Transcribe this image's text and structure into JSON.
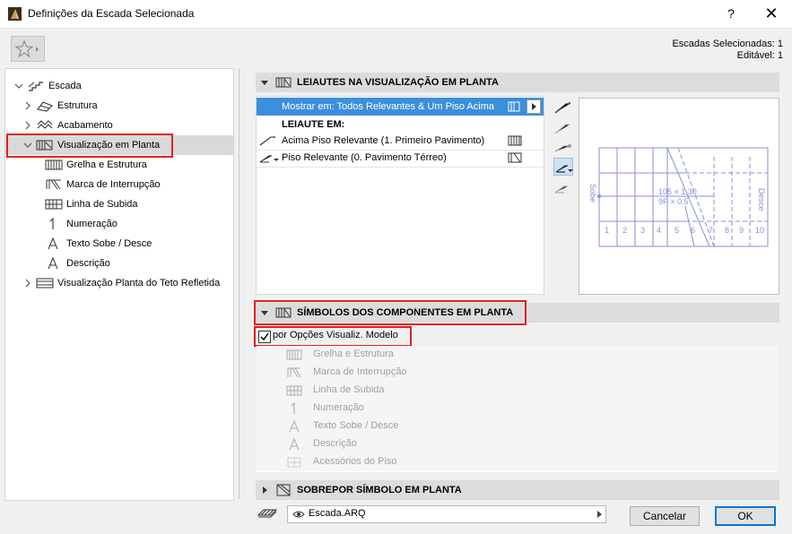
{
  "window": {
    "title": "Definições da Escada Selecionada",
    "help": "?",
    "close": "✕"
  },
  "selection_info": {
    "line1": "Escadas Selecionadas: 1",
    "line2": "Editável: 1"
  },
  "tree": {
    "items": [
      {
        "label": "Escada",
        "icon": "stair-icon"
      },
      {
        "label": "Estrutura",
        "icon": "structure-icon"
      },
      {
        "label": "Acabamento",
        "icon": "finish-icon"
      },
      {
        "label": "Visualização em Planta",
        "icon": "floor-plan-icon"
      },
      {
        "label": "Grelha e Estrutura",
        "icon": "grid-structure-icon"
      },
      {
        "label": "Marca de Interrupção",
        "icon": "break-mark-icon"
      },
      {
        "label": "Linha de Subida",
        "icon": "walking-line-icon"
      },
      {
        "label": "Numeração",
        "icon": "numbering-icon"
      },
      {
        "label": "Texto Sobe / Desce",
        "icon": "up-down-text-icon"
      },
      {
        "label": "Descrição",
        "icon": "description-icon"
      },
      {
        "label": "Visualização Planta do Teto Refletida",
        "icon": "reflected-ceiling-icon"
      }
    ]
  },
  "sections": {
    "layouts_header": "LEIAUTES NA VISUALIZAÇÃO EM PLANTA",
    "symbols_header": "SÍMBOLOS DOS COMPONENTES EM PLANTA",
    "overlay_header": "SOBREPOR SÍMBOLO EM PLANTA"
  },
  "layouts": {
    "show_on": "Mostrar em: Todos Relevantes & Um Piso Acima",
    "layout_in_label": "LEIAUTE EM:",
    "rows": [
      {
        "label": "Acima Piso Relevante (1. Primeiro Pavimento)"
      },
      {
        "label": "Piso Relevante (0. Pavimento Térreo)"
      }
    ]
  },
  "preview": {
    "up_text": "Sobe",
    "down_text": "Desce",
    "dims": "105 × 1.30",
    "dims2": "9P × 0.5",
    "step_numbers": [
      "1",
      "2",
      "3",
      "4",
      "5",
      "6",
      "7",
      "8",
      "9",
      "10"
    ]
  },
  "symbols": {
    "by_model_checkbox": "por Opções Visualiz. Modelo",
    "checked": true,
    "items": [
      {
        "label": "Grelha e Estrutura",
        "icon": "grid-structure-icon"
      },
      {
        "label": "Marca de Interrupção",
        "icon": "break-mark-icon"
      },
      {
        "label": "Linha de Subida",
        "icon": "walking-line-icon"
      },
      {
        "label": "Numeração",
        "icon": "numbering-icon"
      },
      {
        "label": "Texto Sobe / Desce",
        "icon": "up-down-text-icon"
      },
      {
        "label": "Descrição",
        "icon": "description-icon"
      },
      {
        "label": "Acessórios do Piso",
        "icon": "floor-accessories-icon"
      }
    ]
  },
  "bottom": {
    "file_name": "Escada.ARQ",
    "cancel": "Cancelar",
    "ok": "OK"
  },
  "colors": {
    "selection_blue": "#3c8fdc",
    "highlight_red": "#e0201e",
    "preview_lines": "#8a8fd8"
  }
}
